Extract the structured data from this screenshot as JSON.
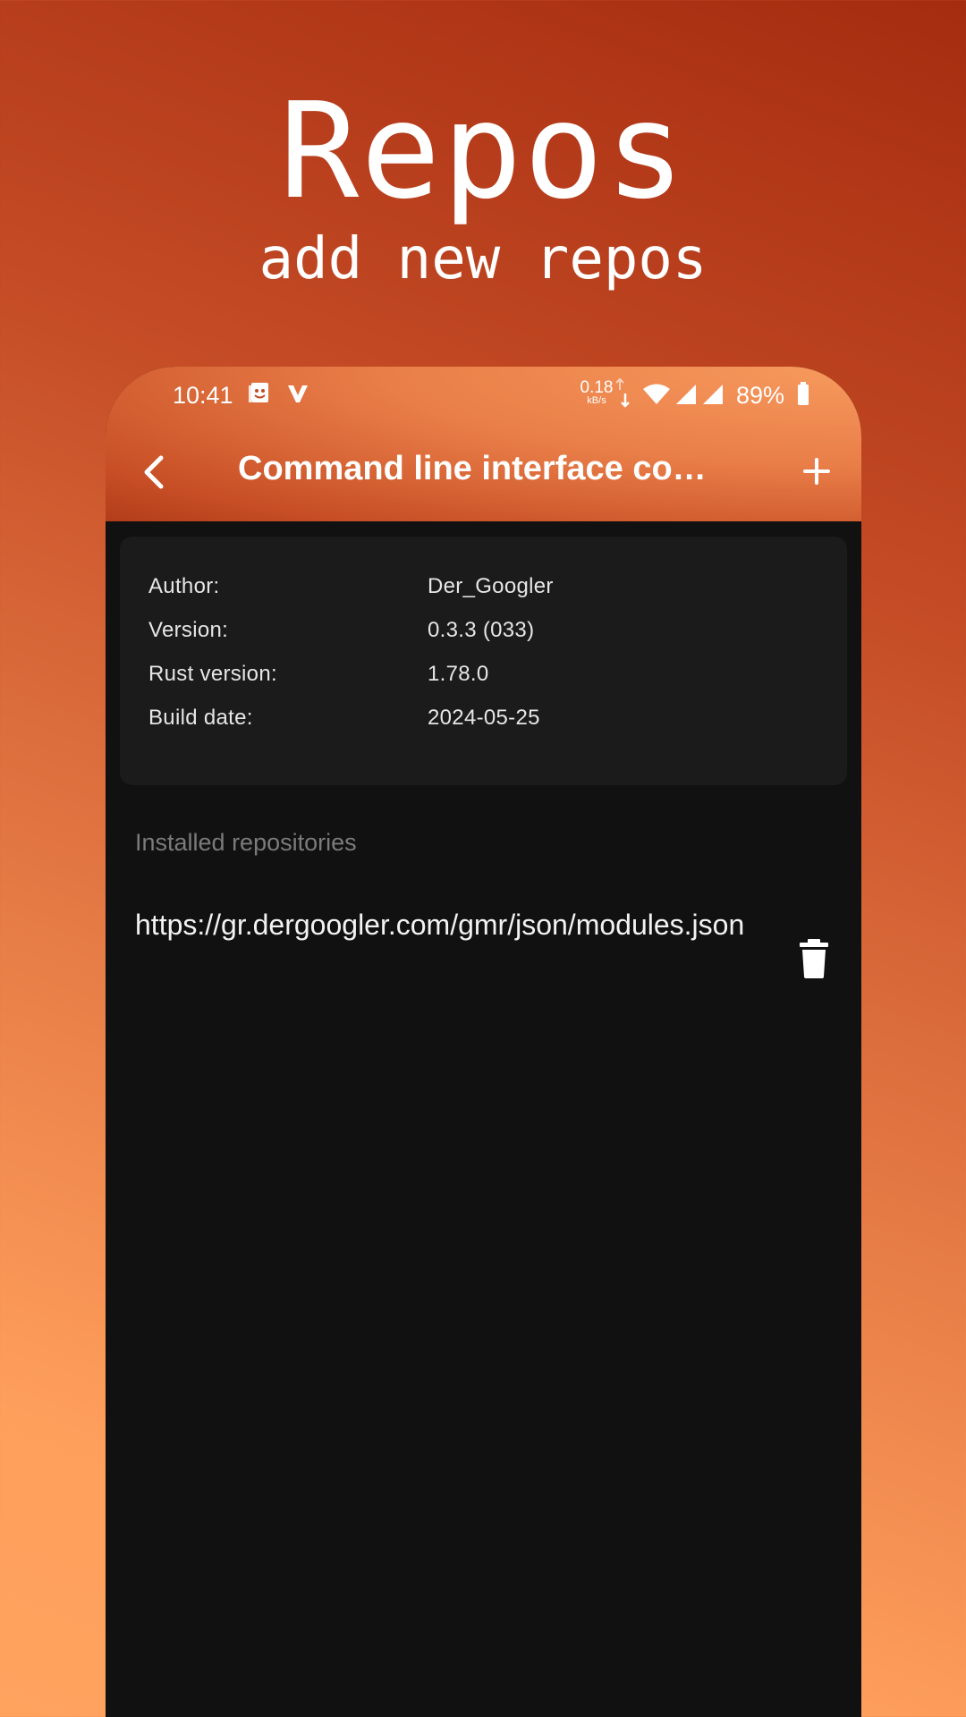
{
  "promo": {
    "title": "Repos",
    "subtitle": "add new repos"
  },
  "status_bar": {
    "time": "10:41",
    "net_speed_value": "0.18",
    "net_speed_unit": "kB/s",
    "battery": "89%",
    "icons": [
      "notification-icon",
      "vivaldi-icon",
      "data-transfer-icon",
      "wifi-icon",
      "cell-signal-icon",
      "cell-signal-icon",
      "battery-icon"
    ]
  },
  "app_bar": {
    "title": "Command line interface co…",
    "back_icon": "chevron-left-icon",
    "add_icon": "plus-icon"
  },
  "info": {
    "rows": [
      {
        "label": "Author:",
        "value": "Der_Googler"
      },
      {
        "label": "Version:",
        "value": "0.3.3 (033)"
      },
      {
        "label": "Rust version:",
        "value": "1.78.0"
      },
      {
        "label": "Build date:",
        "value": "2024-05-25"
      }
    ]
  },
  "repositories": {
    "section_label": "Installed repositories",
    "items": [
      {
        "url": "https://gr.dergoogler.com/gmr/json/modules.json",
        "action_icon": "trash-icon"
      }
    ]
  },
  "colors": {
    "app_bar_accent": "#e97e48",
    "background": "#111111",
    "card": "#1b1b1b",
    "section_label": "#7b7b7b"
  }
}
